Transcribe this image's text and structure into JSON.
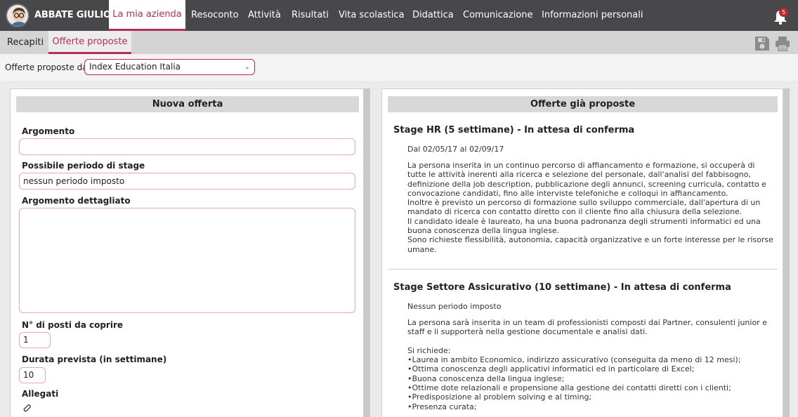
{
  "user": {
    "name": "ABBATE GIULIO"
  },
  "nav": {
    "active": "La mia azienda",
    "items": [
      "Resoconto",
      "Attività",
      "Risultati",
      "Vita scolastica",
      "Didattica",
      "Comunicazione",
      "Informazioni personali"
    ],
    "notifications_count": "5"
  },
  "subtabs": [
    "Recapiti",
    "Offerte proposte"
  ],
  "filter": {
    "label": "Offerte proposte da",
    "value": "Index Education Italia"
  },
  "new_offer": {
    "title": "Nuova offerta",
    "topic_label": "Argomento",
    "topic_value": "",
    "period_label": "Possibile periodo di stage",
    "period_value": "nessun periodo imposto",
    "detail_label": "Argomento dettagliato",
    "detail_value": "",
    "positions_label": "N° di posti da coprire",
    "positions_value": "1",
    "duration_label": "Durata prevista (in settimane)",
    "duration_value": "10",
    "attachments_label": "Allegati"
  },
  "past_offers": {
    "title": "Offerte già proposte",
    "offers": [
      {
        "title": "Stage HR (5 settimane) - In attesa di conferma",
        "period": "Dal 02/05/17 al 02/09/17",
        "lines": [
          "La persona inserita in un continuo percorso di affiancamento e formazione, si occuperà di",
          "tutte le attività inerenti alla ricerca e selezione del personale, dall'analisi del fabbisogno,",
          "definizione della job description, pubblicazione degli annunci, screening curricula, contatto e",
          "convocazione candidati, fino alle interviste telefoniche e colloqui in affiancamento.",
          "Inoltre è previsto un percorso di formazione sullo sviluppo commerciale, dall'apertura di un",
          "mandato di ricerca con contatto diretto con il cliente fino alla chiusura della selezione.",
          "Il candidato ideale è laureato, ha una buona padronanza degli strumenti informatici ed una",
          "buona conoscenza della lingua inglese.",
          "Sono richieste flessibilità, autonomia, capacità organizzative e un forte interesse per le risorse",
          "umane."
        ]
      },
      {
        "title": "Stage Settore Assicurativo (10 settimane) - In attesa di conferma",
        "period": "Nessun periodo imposto",
        "lines": [
          "La persona sarà inserita in un team di professionisti composti dai Partner, consulenti junior e",
          "staff e li supporterà nella gestione documentale e analisi dati.",
          "",
          "Si richiede:",
          "•Laurea in ambito Economico, indirizzo assicurativo (conseguita da meno di 12 mesi);",
          "•Ottima conoscenza degli applicativi informatici ed in particolare di Excel;",
          "•Buona conoscenza della lingua inglese;",
          "•Ottime dote relazionali e propensione alla gestione dei contatti diretti con i clienti;",
          "•Predisposizione al problem solving e al timing;",
          "•Presenza curata;"
        ]
      }
    ]
  },
  "colors": {
    "accent": "#b22d57",
    "topbar": "#48484a",
    "badge": "#c0272d"
  }
}
